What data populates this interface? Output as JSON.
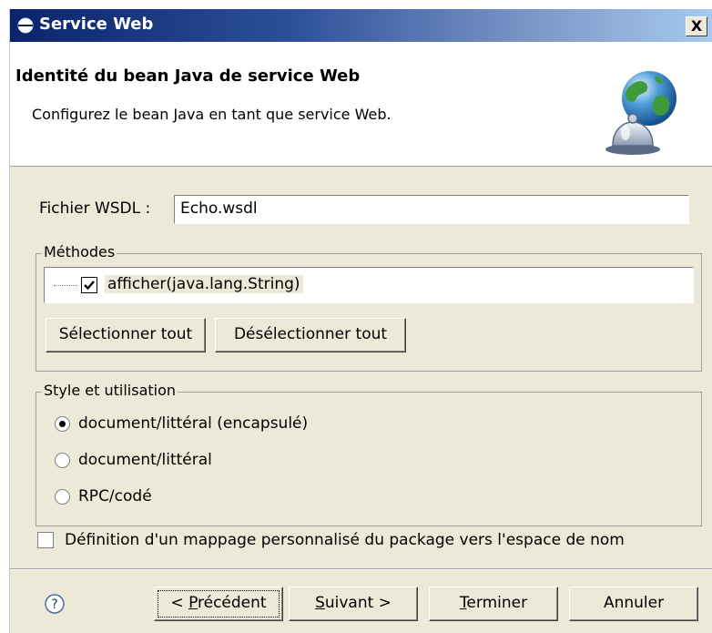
{
  "window": {
    "title": "Service Web",
    "close_label": "X"
  },
  "header": {
    "title": "Identité du bean Java de service Web",
    "description": "Configurez le bean Java en tant que service Web."
  },
  "wsdl": {
    "label": "Fichier WSDL :",
    "value": "Echo.wsdl"
  },
  "methods": {
    "legend": "Méthodes",
    "items": [
      {
        "label": "afficher(java.lang.String)",
        "checked": true
      }
    ],
    "select_all": "Sélectionner tout",
    "deselect_all": "Désélectionner tout"
  },
  "style": {
    "legend": "Style et utilisation",
    "options": [
      {
        "label": "document/littéral (encapsulé)",
        "selected": true
      },
      {
        "label": "document/littéral",
        "selected": false
      },
      {
        "label": "RPC/codé",
        "selected": false
      }
    ]
  },
  "mapping": {
    "label": "Définition d'un mappage personnalisé du package vers l'espace de nom",
    "checked": false
  },
  "footer": {
    "help_icon": "?",
    "back_prefix": "< ",
    "back_mnemonic": "P",
    "back_rest": "récédent",
    "next_mnemonic": "S",
    "next_rest": "uivant >",
    "finish_mnemonic": "T",
    "finish_rest": "erminer",
    "cancel": "Annuler"
  },
  "colors": {
    "titlebar": "#0a246a",
    "dialog_bg": "#ece9d8",
    "checkbox_border": "#1c5180",
    "check_mark": "#21a121"
  }
}
